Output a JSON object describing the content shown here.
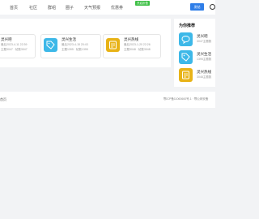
{
  "nav": {
    "items": [
      "首页",
      "社区",
      "群组",
      "圈子",
      "天气预报",
      "优惠券"
    ],
    "fold_badge": "开启折叠",
    "post_button": "发帖"
  },
  "cards": [
    {
      "title": "灵兴吧",
      "meta1": "最后2023-4-11 22:39",
      "meta2": "主题3047 · 帖数3047",
      "icon": "chat-bubble-icon",
      "color": "#3db8e8"
    },
    {
      "title": "灵兴生活",
      "meta1": "最后2023-4-15 20:43",
      "meta2": "主题1395 · 帖数1395",
      "icon": "tag-icon",
      "color": "#3db8e8"
    },
    {
      "title": "灵兴热线",
      "meta1": "最后2023-1-20 22:26",
      "meta2": "主题3048 · 帖数3048",
      "icon": "notepad-icon",
      "color": "#e8b317"
    }
  ],
  "recommend": {
    "title": "为你推荐",
    "items": [
      {
        "name": "灵兴吧",
        "sub": "3047主题数",
        "icon": "chat-bubble-icon",
        "color": "#3db8e8"
      },
      {
        "name": "灵兴生活",
        "sub": "1395主题数",
        "icon": "tag-icon",
        "color": "#3db8e8"
      },
      {
        "name": "灵兴热线",
        "sub": "3048主题数",
        "icon": "notepad-icon",
        "color": "#e8b317"
      }
    ]
  },
  "footer": {
    "left": "首页",
    "right": "鄂ICP备11060660号-1 · 鄂公网安备"
  }
}
